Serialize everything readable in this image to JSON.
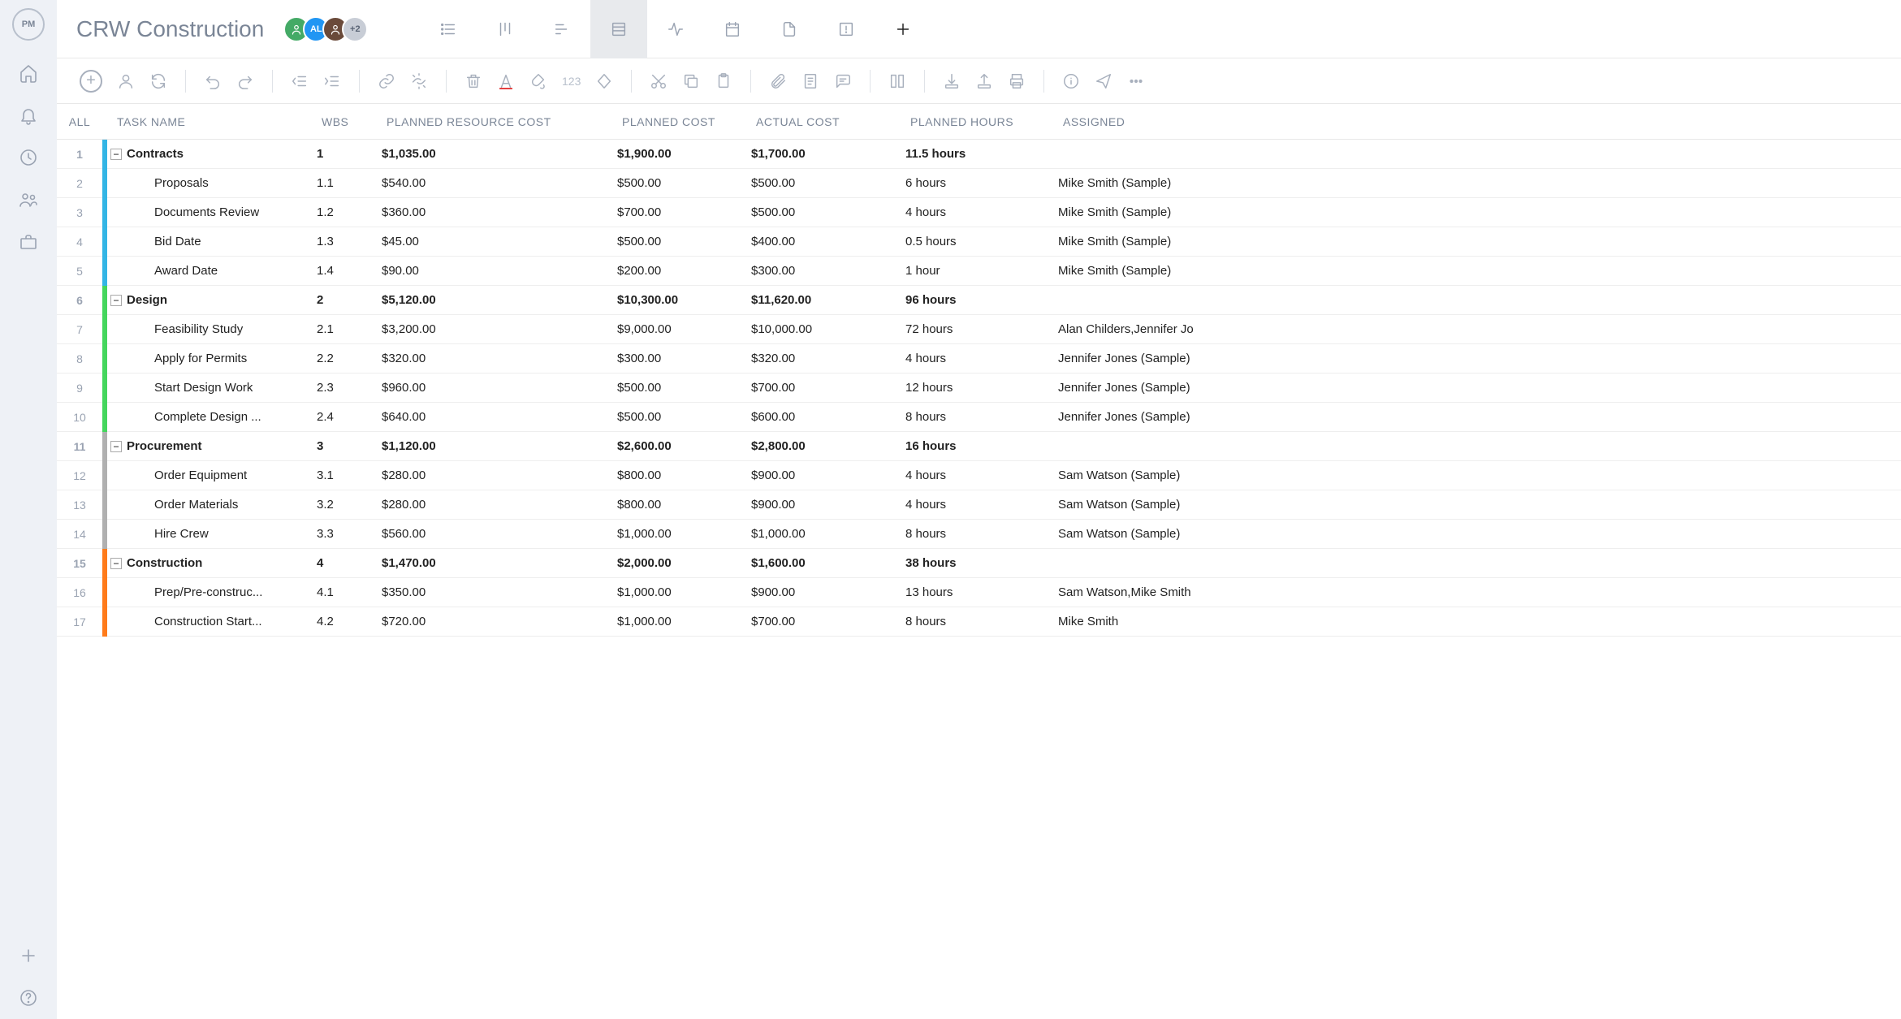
{
  "project_title": "CRW Construction",
  "avatars": [
    "",
    "AL",
    "",
    "+2"
  ],
  "columns": {
    "all": "ALL",
    "task_name": "TASK NAME",
    "wbs": "WBS",
    "planned_resource_cost": "PLANNED RESOURCE COST",
    "planned_cost": "PLANNED COST",
    "actual_cost": "ACTUAL COST",
    "planned_hours": "PLANNED HOURS",
    "assigned": "ASSIGNED"
  },
  "toolbar": {
    "numbers_label": "123"
  },
  "rows": [
    {
      "n": 1,
      "color": "#33b5e5",
      "summary": true,
      "expanded": true,
      "indent": 0,
      "name": "Contracts",
      "wbs": "1",
      "prc": "$1,035.00",
      "pc": "$1,900.00",
      "ac": "$1,700.00",
      "ph": "11.5 hours",
      "assigned": ""
    },
    {
      "n": 2,
      "color": "#33b5e5",
      "summary": false,
      "indent": 1,
      "name": "Proposals",
      "wbs": "1.1",
      "prc": "$540.00",
      "pc": "$500.00",
      "ac": "$500.00",
      "ph": "6 hours",
      "assigned": "Mike Smith (Sample)"
    },
    {
      "n": 3,
      "color": "#33b5e5",
      "summary": false,
      "indent": 1,
      "name": "Documents Review",
      "wbs": "1.2",
      "prc": "$360.00",
      "pc": "$700.00",
      "ac": "$500.00",
      "ph": "4 hours",
      "assigned": "Mike Smith (Sample)"
    },
    {
      "n": 4,
      "color": "#33b5e5",
      "summary": false,
      "indent": 1,
      "name": "Bid Date",
      "wbs": "1.3",
      "prc": "$45.00",
      "pc": "$500.00",
      "ac": "$400.00",
      "ph": "0.5 hours",
      "assigned": "Mike Smith (Sample)"
    },
    {
      "n": 5,
      "color": "#33b5e5",
      "summary": false,
      "indent": 1,
      "name": "Award Date",
      "wbs": "1.4",
      "prc": "$90.00",
      "pc": "$200.00",
      "ac": "$300.00",
      "ph": "1 hour",
      "assigned": "Mike Smith (Sample)"
    },
    {
      "n": 6,
      "color": "#44d65c",
      "summary": true,
      "expanded": true,
      "indent": 0,
      "name": "Design",
      "wbs": "2",
      "prc": "$5,120.00",
      "pc": "$10,300.00",
      "ac": "$11,620.00",
      "ph": "96 hours",
      "assigned": ""
    },
    {
      "n": 7,
      "color": "#44d65c",
      "summary": false,
      "indent": 1,
      "name": "Feasibility Study",
      "wbs": "2.1",
      "prc": "$3,200.00",
      "pc": "$9,000.00",
      "ac": "$10,000.00",
      "ph": "72 hours",
      "assigned": "Alan Childers,Jennifer Jo"
    },
    {
      "n": 8,
      "color": "#44d65c",
      "summary": false,
      "indent": 1,
      "name": "Apply for Permits",
      "wbs": "2.2",
      "prc": "$320.00",
      "pc": "$300.00",
      "ac": "$320.00",
      "ph": "4 hours",
      "assigned": "Jennifer Jones (Sample)"
    },
    {
      "n": 9,
      "color": "#44d65c",
      "summary": false,
      "indent": 1,
      "name": "Start Design Work",
      "wbs": "2.3",
      "prc": "$960.00",
      "pc": "$500.00",
      "ac": "$700.00",
      "ph": "12 hours",
      "assigned": "Jennifer Jones (Sample)"
    },
    {
      "n": 10,
      "color": "#44d65c",
      "summary": false,
      "indent": 1,
      "name": "Complete Design ...",
      "wbs": "2.4",
      "prc": "$640.00",
      "pc": "$500.00",
      "ac": "$600.00",
      "ph": "8 hours",
      "assigned": "Jennifer Jones (Sample)"
    },
    {
      "n": 11,
      "color": "#b0b0b0",
      "summary": true,
      "expanded": true,
      "indent": 0,
      "name": "Procurement",
      "wbs": "3",
      "prc": "$1,120.00",
      "pc": "$2,600.00",
      "ac": "$2,800.00",
      "ph": "16 hours",
      "assigned": ""
    },
    {
      "n": 12,
      "color": "#b0b0b0",
      "summary": false,
      "indent": 1,
      "name": "Order Equipment",
      "wbs": "3.1",
      "prc": "$280.00",
      "pc": "$800.00",
      "ac": "$900.00",
      "ph": "4 hours",
      "assigned": "Sam Watson (Sample)"
    },
    {
      "n": 13,
      "color": "#b0b0b0",
      "summary": false,
      "indent": 1,
      "name": "Order Materials",
      "wbs": "3.2",
      "prc": "$280.00",
      "pc": "$800.00",
      "ac": "$900.00",
      "ph": "4 hours",
      "assigned": "Sam Watson (Sample)"
    },
    {
      "n": 14,
      "color": "#b0b0b0",
      "summary": false,
      "indent": 1,
      "name": "Hire Crew",
      "wbs": "3.3",
      "prc": "$560.00",
      "pc": "$1,000.00",
      "ac": "$1,000.00",
      "ph": "8 hours",
      "assigned": "Sam Watson (Sample)"
    },
    {
      "n": 15,
      "color": "#ff7b1a",
      "summary": true,
      "expanded": true,
      "indent": 0,
      "name": "Construction",
      "wbs": "4",
      "prc": "$1,470.00",
      "pc": "$2,000.00",
      "ac": "$1,600.00",
      "ph": "38 hours",
      "assigned": ""
    },
    {
      "n": 16,
      "color": "#ff7b1a",
      "summary": false,
      "indent": 1,
      "name": "Prep/Pre-construc...",
      "wbs": "4.1",
      "prc": "$350.00",
      "pc": "$1,000.00",
      "ac": "$900.00",
      "ph": "13 hours",
      "assigned": "Sam Watson,Mike Smith"
    },
    {
      "n": 17,
      "color": "#ff7b1a",
      "summary": false,
      "indent": 1,
      "name": "Construction Start...",
      "wbs": "4.2",
      "prc": "$720.00",
      "pc": "$1,000.00",
      "ac": "$700.00",
      "ph": "8 hours",
      "assigned": "Mike Smith"
    }
  ]
}
